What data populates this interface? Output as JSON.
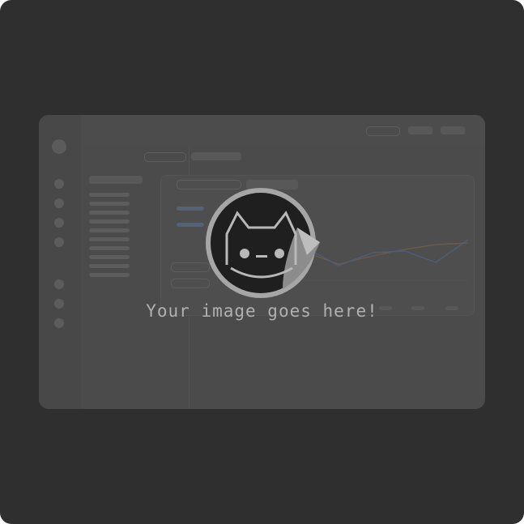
{
  "placeholder": {
    "caption": "Your image goes here!",
    "icon": "cat-sticker-icon"
  },
  "colors": {
    "background": "#2f2f2f",
    "card": "#4a4b4a",
    "sticker_fill": "#1f1f1f",
    "sticker_rim": "#a6a6a6",
    "caption_text": "#b0b0b0"
  }
}
